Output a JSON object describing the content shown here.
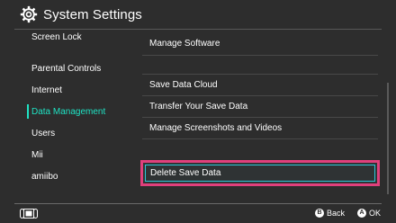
{
  "header": {
    "icon": "gear-icon",
    "title": "System Settings"
  },
  "sidebar": {
    "items": [
      {
        "label": "Screen Lock",
        "active": false
      },
      {
        "label": "Parental Controls",
        "active": false
      },
      {
        "label": "Internet",
        "active": false
      },
      {
        "label": "Data Management",
        "active": true
      },
      {
        "label": "Users",
        "active": false
      },
      {
        "label": "Mii",
        "active": false
      },
      {
        "label": "amiibo",
        "active": false
      }
    ]
  },
  "main": {
    "items": [
      {
        "label": "Manage Software"
      },
      {
        "label": "Save Data Cloud"
      },
      {
        "label": "Transfer Your Save Data"
      },
      {
        "label": "Manage Screenshots and Videos"
      },
      {
        "label": "Delete Save Data",
        "selected": true
      }
    ]
  },
  "footer": {
    "console_icon": "console-icon",
    "back": {
      "button": "B",
      "label": "Back"
    },
    "ok": {
      "button": "A",
      "label": "OK"
    }
  },
  "colors": {
    "background": "#2d2d2d",
    "accent": "#1fe3c4",
    "selection_outer": "#e0407c",
    "selection_inner": "#2ec8d8",
    "text": "#ffffff"
  }
}
